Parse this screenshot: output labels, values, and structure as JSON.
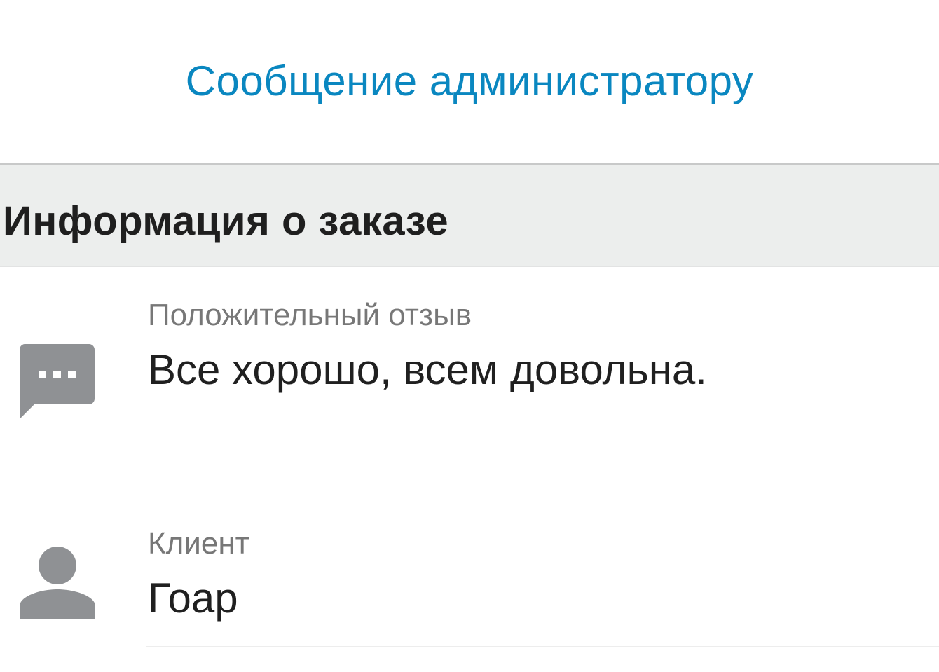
{
  "top_action": {
    "label": "Сообщение администратору",
    "color": "#0a87c0"
  },
  "section": {
    "title": "Информация о заказе"
  },
  "rows": [
    {
      "icon": "chat-bubble-icon",
      "label": "Положительный отзыв",
      "value": "Все хорошо, всем довольна."
    },
    {
      "icon": "person-icon",
      "label": "Клиент",
      "value": "Гоар"
    }
  ],
  "colors": {
    "header_bg": "#eceeed",
    "icon_gray": "#8f9194",
    "label_gray": "#777777",
    "text_dark": "#202020"
  }
}
